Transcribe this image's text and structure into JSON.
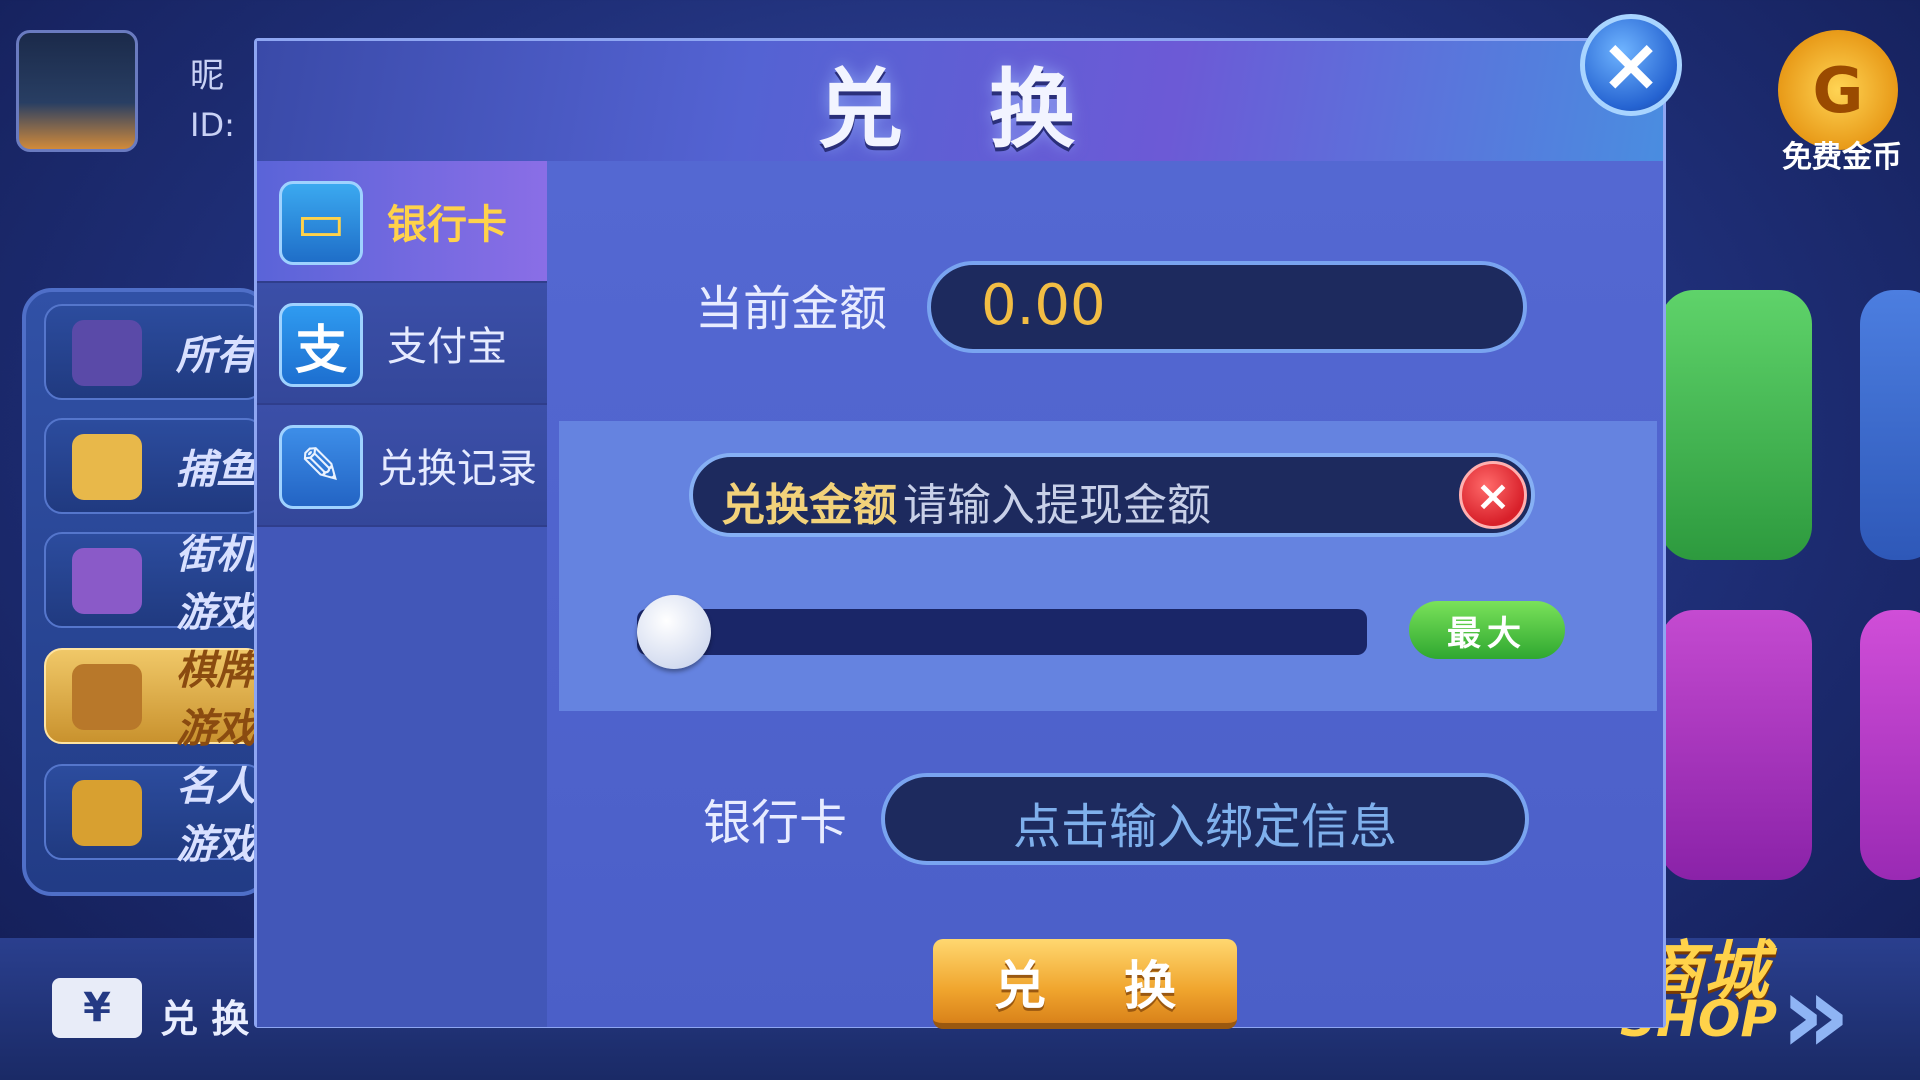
{
  "background": {
    "nickname_prefix": "昵",
    "id_prefix": "ID:",
    "lobby_buttons": [
      "所有",
      "捕鱼",
      "街机游戏",
      "棋牌游戏",
      "名人游戏"
    ],
    "free_coin_label": "免费金币",
    "free_coin_symbol": "G",
    "bottom_exchange_icon": "¥",
    "bottom_exchange_label": "兑 换",
    "shop_cn": "商城",
    "shop_en": "SHOP"
  },
  "modal": {
    "title": "兑 换",
    "close_icon": "×",
    "tabs": [
      {
        "label": "银行卡",
        "icon": "bank-card-icon",
        "active": true
      },
      {
        "label": "支付宝",
        "icon": "alipay-icon",
        "active": false
      },
      {
        "label": "兑换记录",
        "icon": "record-clipboard-icon",
        "active": false
      }
    ],
    "current_amount_label": "当前金额",
    "current_amount_value": "0.00",
    "exchange_amount_label": "兑换金额",
    "exchange_amount_placeholder": "请输入提现金额",
    "clear_icon": "×",
    "slider_value": 0,
    "max_button_label": "最大",
    "bank_card_label": "银行卡",
    "bank_card_placeholder": "点击输入绑定信息",
    "submit_label": "兑 换"
  },
  "colors": {
    "accent_gold": "#f2bd44",
    "panel_blue": "#4c62c8",
    "field_dark": "#1d2a5e",
    "max_green": "#2fa830"
  }
}
